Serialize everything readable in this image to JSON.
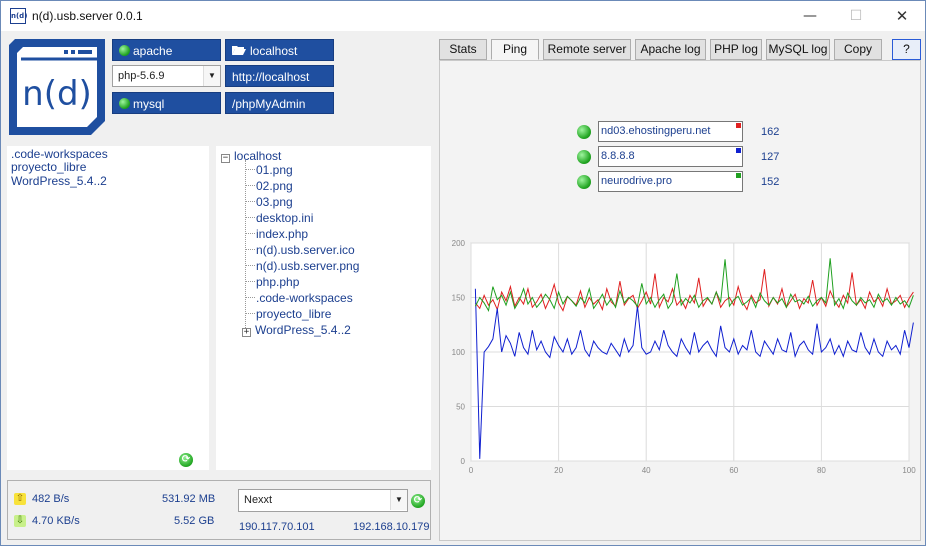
{
  "window": {
    "title": "n(d).usb.server 0.0.1",
    "icon": "app-icon",
    "app_icon_text": "n(d)",
    "logo_text": "n(d)",
    "min": "—",
    "max": "☐",
    "close": "✕"
  },
  "services": {
    "apache_label": "apache",
    "php_version": "php-5.6.9",
    "mysql_label": "mysql",
    "localhost_label": "localhost",
    "url_label": "http://localhost",
    "phpmyadmin_label": "/phpMyAdmin"
  },
  "projects": [
    ".code-workspaces",
    "proyecto_libre",
    "WordPress_5.4..2"
  ],
  "tree": {
    "root": "localhost",
    "root_box": "−",
    "last_box": "+",
    "items": [
      "01.png",
      "02.png",
      "03.png",
      "desktop.ini",
      "index.php",
      "n(d).usb.server.ico",
      "n(d).usb.server.png",
      "php.php",
      ".code-workspaces",
      "proyecto_libre",
      "WordPress_5.4..2"
    ]
  },
  "status": {
    "upload_rate": "482 B/s",
    "upload_total": "531.92 MB",
    "download_rate": "4.70 KB/s",
    "download_total": "5.52 GB",
    "network": "Nexxt",
    "public_ip": "190.117.70.101",
    "local_ip": "192.168.10.179"
  },
  "tabs": [
    "Stats",
    "Ping",
    "Remote server",
    "Apache log",
    "PHP log",
    "MySQL log",
    "Copy",
    "?"
  ],
  "active_tab": "Ping",
  "ping_hosts": [
    {
      "host": "nd03.ehostingperu.net",
      "ms": "162",
      "color": "#e02020"
    },
    {
      "host": "8.8.8.8",
      "ms": "127",
      "color": "#1020d0"
    },
    {
      "host": "neurodrive.pro",
      "ms": "152",
      "color": "#20a020"
    }
  ],
  "chart_data": {
    "type": "line",
    "xlim": [
      0,
      100
    ],
    "ylim": [
      0,
      200
    ],
    "xticks": [
      0,
      20,
      40,
      60,
      80,
      100
    ],
    "yticks": [
      0,
      50,
      100,
      150,
      200
    ],
    "grid": true,
    "x_start": 1,
    "series": [
      {
        "color": "#e02020",
        "values": [
          145,
          140,
          152,
          143,
          148,
          139,
          155,
          147,
          160,
          142,
          150,
          144,
          158,
          141,
          146,
          153,
          140,
          149,
          162,
          145,
          138,
          151,
          147,
          143,
          156,
          141,
          150,
          144,
          148,
          139,
          158,
          146,
          142,
          165,
          143,
          149,
          152,
          140,
          147,
          155,
          144,
          172,
          141,
          150,
          146,
          158,
          143,
          148,
          140,
          152,
          145,
          168,
          142,
          149,
          144,
          155,
          141,
          147,
          150,
          143,
          160,
          146,
          139,
          152,
          145,
          148,
          176,
          142,
          150,
          144,
          158,
          141,
          147,
          153,
          140,
          149,
          145,
          166,
          143,
          150,
          142,
          156,
          147,
          141,
          152,
          145,
          173,
          143,
          148,
          140,
          155,
          146,
          150,
          142,
          158,
          144,
          147,
          152,
          141,
          149,
          155
        ]
      },
      {
        "color": "#1020d0",
        "values": [
          158,
          2,
          100,
          105,
          112,
          140,
          100,
          115,
          108,
          96,
          118,
          104,
          98,
          120,
          102,
          110,
          100,
          95,
          114,
          106,
          100,
          112,
          98,
          104,
          120,
          102,
          96,
          110,
          104,
          100,
          98,
          108,
          102,
          96,
          112,
          100,
          106,
          142,
          104,
          98,
          100,
          110,
          102,
          120,
          106,
          100,
          96,
          112,
          104,
          98,
          118,
          100,
          106,
          110,
          102,
          96,
          124,
          104,
          100,
          112,
          98,
          106,
          102,
          120,
          100,
          96,
          110,
          104,
          98,
          112,
          102,
          100,
          118,
          96,
          106,
          110,
          102,
          98,
          126,
          100,
          104,
          112,
          98,
          106,
          96,
          110,
          102,
          100,
          118,
          104,
          98,
          112,
          100,
          96,
          110,
          102,
          106,
          98,
          120,
          104,
          127
        ]
      },
      {
        "color": "#20a020",
        "values": [
          142,
          150,
          145,
          138,
          160,
          148,
          152,
          143,
          155,
          140,
          147,
          158,
          144,
          150,
          141,
          146,
          153,
          148,
          140,
          155,
          144,
          151,
          147,
          142,
          150,
          145,
          158,
          140,
          146,
          153,
          143,
          149,
          141,
          156,
          145,
          150,
          147,
          142,
          163,
          144,
          150,
          141,
          148,
          153,
          140,
          146,
          172,
          143,
          149,
          145,
          152,
          141,
          147,
          150,
          144,
          155,
          146,
          185,
          142,
          148,
          151,
          143,
          146,
          150,
          141,
          154,
          147,
          143,
          150,
          145,
          149,
          141,
          153,
          146,
          148,
          144,
          151,
          142,
          147,
          150,
          145,
          186,
          143,
          149,
          140,
          154,
          147,
          143,
          150,
          145,
          148,
          141,
          153,
          146,
          149,
          143,
          150,
          144,
          147,
          141,
          152
        ]
      }
    ]
  }
}
